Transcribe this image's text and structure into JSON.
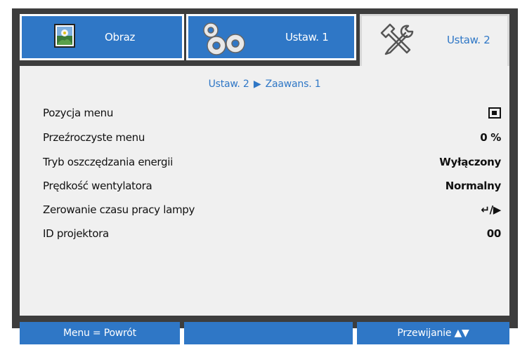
{
  "tabs": [
    {
      "label": "Obraz",
      "icon": "image-icon",
      "active": false
    },
    {
      "label": "Ustaw. 1",
      "icon": "gears-icon",
      "active": false
    },
    {
      "label": "Ustaw. 2",
      "icon": "tools-icon",
      "active": true
    }
  ],
  "breadcrumb": {
    "parent": "Ustaw. 2",
    "separator": "▶",
    "current": "Zaawans. 1"
  },
  "settings": [
    {
      "label": "Pozycja menu",
      "value": "",
      "value_icon": "menu-position-icon"
    },
    {
      "label": "Przeźroczyste menu",
      "value": "0 %"
    },
    {
      "label": "Tryb oszczędzania energii",
      "value": "Wyłączony"
    },
    {
      "label": "Prędkość wentylatora",
      "value": "Normalny"
    },
    {
      "label": "Zerowanie czasu pracy lampy",
      "value": "↵/▶"
    },
    {
      "label": "ID projektora",
      "value": "00"
    }
  ],
  "footer": {
    "left": "Menu = Powrót",
    "middle": "",
    "right": "Przewijanie ▲▼"
  },
  "colors": {
    "accent": "#2f77c6",
    "frame": "#3d3d3d",
    "panel": "#f0f0f0"
  }
}
